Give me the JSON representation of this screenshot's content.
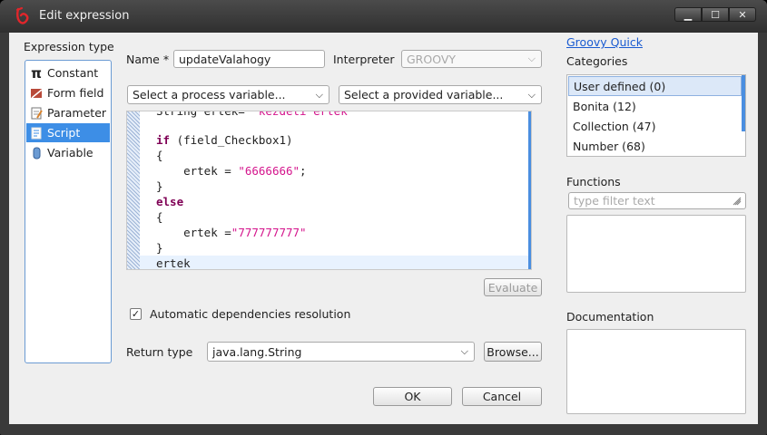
{
  "window": {
    "title": "Edit expression"
  },
  "expression_type": {
    "heading": "Expression type",
    "items": [
      {
        "label": "Constant",
        "icon": "pi-icon",
        "glyph": "π"
      },
      {
        "label": "Form field",
        "icon": "form-field-icon",
        "glyph": "▰"
      },
      {
        "label": "Parameter",
        "icon": "parameter-icon",
        "glyph": "▤"
      },
      {
        "label": "Script",
        "icon": "script-icon",
        "glyph": "▦",
        "selected": true
      },
      {
        "label": "Variable",
        "icon": "variable-icon",
        "glyph": "▮"
      }
    ]
  },
  "form": {
    "name_label": "Name *",
    "name_value": "updateValahogy",
    "interpreter_label": "Interpreter",
    "interpreter_value": "GROOVY",
    "process_variable_placeholder": "Select a process variable...",
    "provided_variable_placeholder": "Select a provided variable..."
  },
  "code": {
    "lines": [
      "String ertek= \"kezdeti ertek\"",
      "",
      "if (field_Checkbox1)",
      "{",
      "    ertek = \"6666666\";",
      "}",
      "else",
      "{",
      "    ertek =\"777777777\"",
      "}",
      "ertek"
    ]
  },
  "actions": {
    "evaluate_label": "Evaluate",
    "auto_dependencies_label": "Automatic dependencies resolution",
    "auto_dependencies_checked": true,
    "return_type_label": "Return type",
    "return_type_value": "java.lang.String",
    "browse_label": "Browse...",
    "ok_label": "OK",
    "cancel_label": "Cancel"
  },
  "right_panel": {
    "link_text": "Groovy Quick",
    "categories_heading": "Categories",
    "categories": [
      {
        "label": "User defined (0)",
        "selected": true
      },
      {
        "label": "Bonita (12)"
      },
      {
        "label": "Collection (47)"
      },
      {
        "label": "Number (68)"
      }
    ],
    "functions_heading": "Functions",
    "filter_placeholder": "type filter text",
    "documentation_heading": "Documentation"
  },
  "colors": {
    "selection": "#3d8ee6",
    "keyword": "#7f0055",
    "string": "#d4148c",
    "link": "#1a5bd1"
  }
}
